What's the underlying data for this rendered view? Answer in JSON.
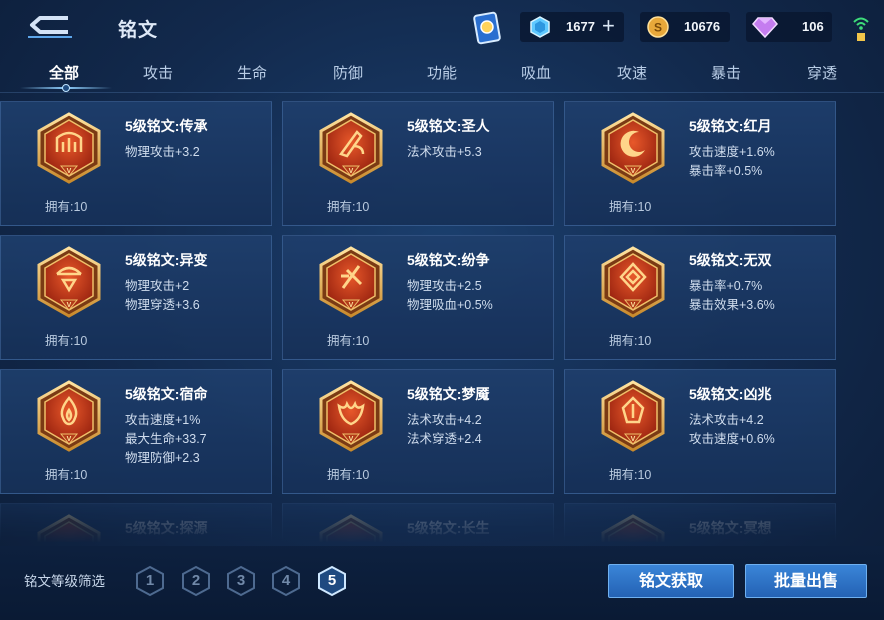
{
  "header": {
    "title": "铭文",
    "coupons": "1677",
    "gold": "10676",
    "diamonds": "106"
  },
  "tabs": [
    {
      "label": "全部",
      "active": true
    },
    {
      "label": "攻击"
    },
    {
      "label": "生命"
    },
    {
      "label": "防御"
    },
    {
      "label": "功能"
    },
    {
      "label": "吸血"
    },
    {
      "label": "攻速"
    },
    {
      "label": "暴击"
    },
    {
      "label": "穿透"
    }
  ],
  "runes": [
    {
      "name": "5级铭文:传承",
      "attrs": [
        "物理攻击+3.2"
      ],
      "own": "拥有:10",
      "icon": "rune-chuancheng-icon"
    },
    {
      "name": "5级铭文:圣人",
      "attrs": [
        "法术攻击+5.3"
      ],
      "own": "拥有:10",
      "icon": "rune-shengren-icon"
    },
    {
      "name": "5级铭文:红月",
      "attrs": [
        "攻击速度+1.6%",
        "暴击率+0.5%"
      ],
      "own": "拥有:10",
      "icon": "rune-hongyue-icon"
    },
    {
      "name": "5级铭文:异变",
      "attrs": [
        "物理攻击+2",
        "物理穿透+3.6"
      ],
      "own": "拥有:10",
      "icon": "rune-yibian-icon"
    },
    {
      "name": "5级铭文:纷争",
      "attrs": [
        "物理攻击+2.5",
        "物理吸血+0.5%"
      ],
      "own": "拥有:10",
      "icon": "rune-fenzheng-icon"
    },
    {
      "name": "5级铭文:无双",
      "attrs": [
        "暴击率+0.7%",
        "暴击效果+3.6%"
      ],
      "own": "拥有:10",
      "icon": "rune-wushuang-icon"
    },
    {
      "name": "5级铭文:宿命",
      "attrs": [
        "攻击速度+1%",
        "最大生命+33.7",
        "物理防御+2.3"
      ],
      "own": "拥有:10",
      "icon": "rune-suming-icon"
    },
    {
      "name": "5级铭文:梦魇",
      "attrs": [
        "法术攻击+4.2",
        "法术穿透+2.4"
      ],
      "own": "拥有:10",
      "icon": "rune-mengyan-icon"
    },
    {
      "name": "5级铭文:凶兆",
      "attrs": [
        "法术攻击+4.2",
        "攻击速度+0.6%"
      ],
      "own": "拥有:10",
      "icon": "rune-xiongzhao-icon"
    }
  ],
  "faded_runes": [
    "5级铭文:探源",
    "5级铭文:长生",
    "5级铭文:冥想"
  ],
  "footer": {
    "filter_label": "铭文等级筛选",
    "levels": [
      "1",
      "2",
      "3",
      "4",
      "5"
    ],
    "active_level": "5",
    "get_button": "铭文获取",
    "sell_button": "批量出售"
  },
  "colors": {
    "emblem_red": "#c93a1c",
    "emblem_gold": "#e7b04c",
    "button_blue": "#2f74c8"
  }
}
